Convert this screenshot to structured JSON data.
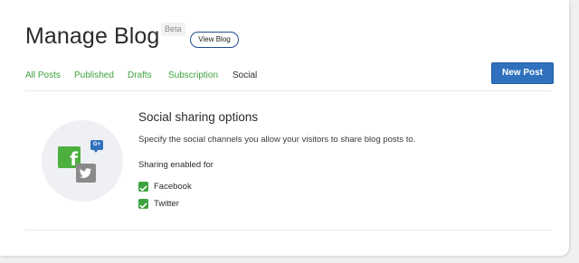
{
  "header": {
    "title": "Manage Blog",
    "badge": "Beta",
    "view_blog_label": "View Blog",
    "new_post_label": "New Post"
  },
  "tabs": [
    {
      "label": "All Posts",
      "active": false
    },
    {
      "label": "Published",
      "active": false
    },
    {
      "label": "Drafts",
      "active": false
    },
    {
      "label": "Subscription",
      "active": false
    },
    {
      "label": "Social",
      "active": true
    }
  ],
  "social": {
    "title": "Social sharing options",
    "description": "Specify the social channels you allow your visitors to share blog posts to.",
    "sharing_label": "Sharing enabled for",
    "channels": [
      {
        "label": "Facebook",
        "checked": true
      },
      {
        "label": "Twitter",
        "checked": true
      }
    ],
    "illustration_icons": [
      "facebook-icon",
      "twitter-icon",
      "google-plus-icon"
    ]
  },
  "colors": {
    "accent_green": "#3fa33f",
    "primary_blue": "#2f71bd",
    "text_dark": "#2b2b2b"
  }
}
